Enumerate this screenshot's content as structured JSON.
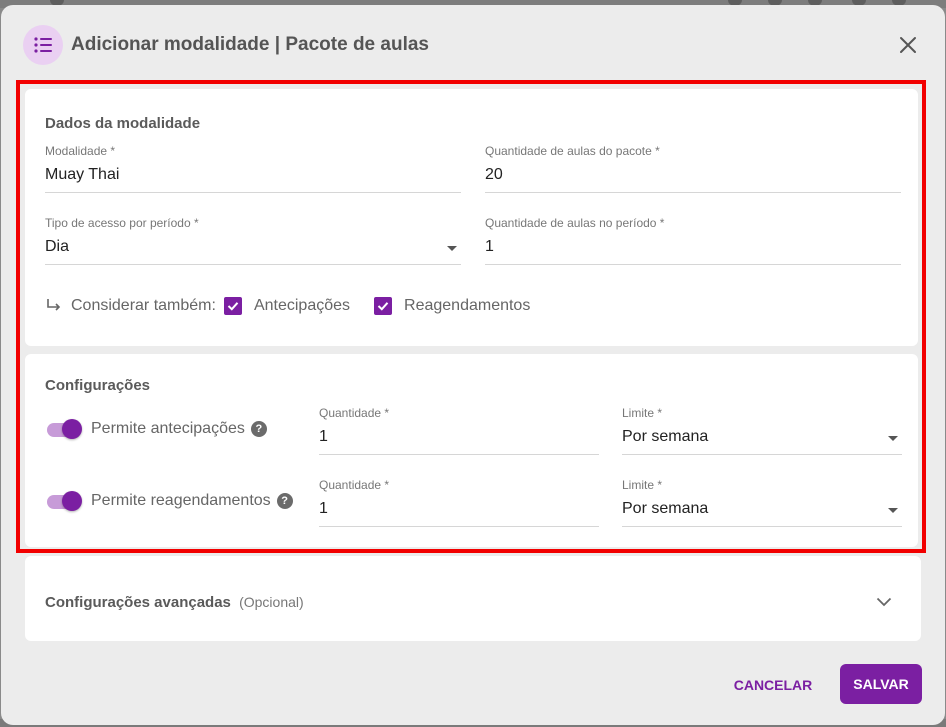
{
  "colors": {
    "accent": "#7b1fa2",
    "accent_light": "#ead0f2",
    "highlight_border": "#f20000",
    "dialog_bg": "#ececec",
    "card_bg": "#ffffff"
  },
  "header": {
    "icon": "list-icon",
    "title": "Adicionar modalidade | Pacote de aulas",
    "close_icon": "close-icon"
  },
  "dados": {
    "title": "Dados da modalidade",
    "modalidade": {
      "label": "Modalidade *",
      "value": "Muay Thai"
    },
    "quantidade_pacote": {
      "label": "Quantidade de aulas do pacote *",
      "value": "20"
    },
    "tipo_acesso": {
      "label": "Tipo de acesso por período *",
      "value": "Dia"
    },
    "quantidade_periodo": {
      "label": "Quantidade de aulas no período *",
      "value": "1"
    },
    "considerar": {
      "label": "Considerar também:",
      "antecipacoes": {
        "label": "Antecipações",
        "checked": true
      },
      "reagendamentos": {
        "label": "Reagendamentos",
        "checked": true
      }
    }
  },
  "configuracoes": {
    "title": "Configurações",
    "antecipacoes": {
      "label": "Permite antecipações",
      "enabled": true,
      "quantidade": {
        "label": "Quantidade *",
        "value": "1"
      },
      "limite": {
        "label": "Limite *",
        "value": "Por semana"
      }
    },
    "reagendamentos": {
      "label": "Permite reagendamentos",
      "enabled": true,
      "quantidade": {
        "label": "Quantidade *",
        "value": "1"
      },
      "limite": {
        "label": "Limite *",
        "value": "Por semana"
      }
    }
  },
  "avancadas": {
    "title": "Configurações avançadas",
    "optional": "(Opcional)"
  },
  "actions": {
    "cancel": "CANCELAR",
    "save": "SALVAR"
  }
}
